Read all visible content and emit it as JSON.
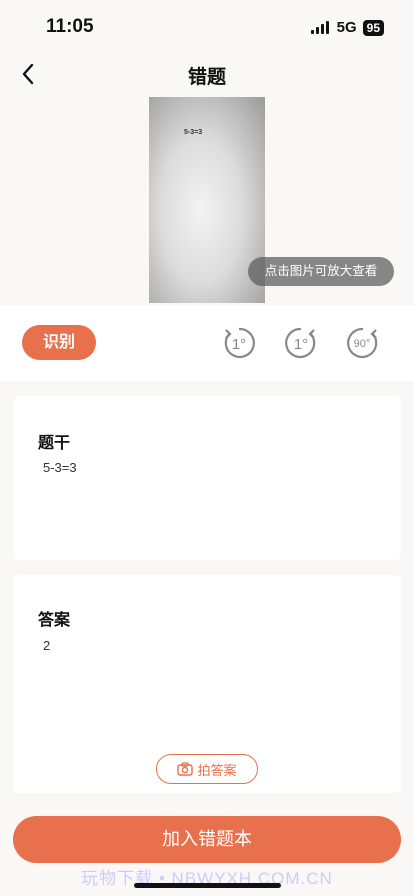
{
  "status_bar": {
    "time": "11:05",
    "network": "5G",
    "battery": "95"
  },
  "nav": {
    "title": "错题"
  },
  "photo": {
    "content_text": "5-3=3",
    "zoom_hint": "点击图片可放大查看"
  },
  "toolbar": {
    "recognize_label": "识别",
    "rotate_left_label": "1°",
    "rotate_right_label": "1°",
    "rotate_90_label": "90°"
  },
  "stem": {
    "label": "题干",
    "value": "5-3=3"
  },
  "answer": {
    "label": "答案",
    "value": "2",
    "photo_button_label": "拍答案"
  },
  "footer": {
    "add_button_label": "加入错题本",
    "watermark": "玩物下载 • NBWYXH.COM.CN"
  },
  "colors": {
    "accent": "#e8704c"
  }
}
